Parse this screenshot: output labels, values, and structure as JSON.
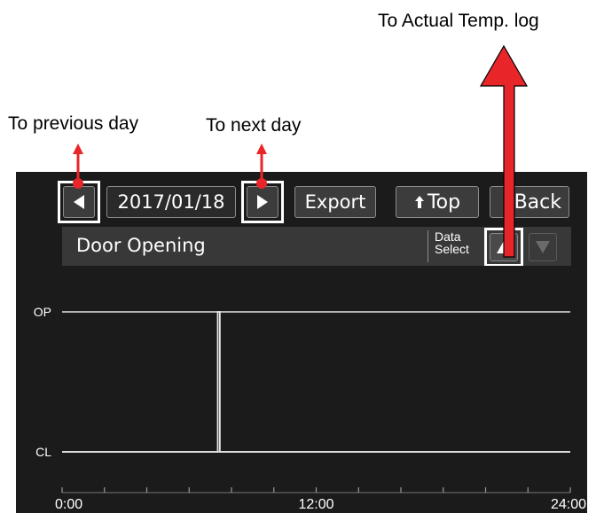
{
  "annotations": {
    "previous_day": "To previous day",
    "next_day": "To next day",
    "actual_temp_log": "To Actual Temp. log"
  },
  "toolbar": {
    "prev_icon": "left-triangle-icon",
    "date": "2017/01/18",
    "next_icon": "right-triangle-icon",
    "export_label": "Export",
    "top_label": "Top",
    "top_icon": "up-arrow-icon",
    "back_label": "Back"
  },
  "panel": {
    "title": "Door Opening",
    "data_select_line1": "Data",
    "data_select_line2": "Select",
    "up_icon": "up-triangle-icon",
    "down_icon": "down-triangle-icon"
  },
  "colors": {
    "screen_bg": "#1b1b1b",
    "header_bg": "#383838",
    "trace": "#e6e6e6",
    "annotation_arrow": "#e8262a"
  },
  "chart_data": {
    "type": "line",
    "title": "Door Opening",
    "y_categories": [
      "CL",
      "OP"
    ],
    "x_ticks": [
      "0:00",
      "12:00",
      "24:00"
    ],
    "x_unit": "hours",
    "xlim": [
      0,
      24
    ],
    "series": [
      {
        "x": [
          0,
          7.35,
          7.35,
          7.45,
          7.45,
          24
        ],
        "y": [
          "CL",
          "CL",
          "OP",
          "OP",
          "CL",
          "CL"
        ]
      }
    ]
  }
}
